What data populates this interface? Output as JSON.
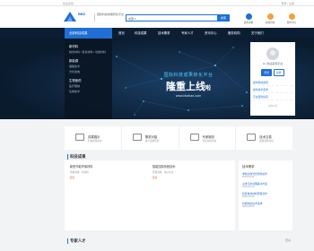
{
  "topbar": {
    "left_text": "欢迎来到",
    "right_text": "登录 | 注册"
  },
  "header": {
    "logo_text": "BBZ",
    "slogan": "国际科技成果转化平台",
    "search": {
      "select_label": "成果 ▾",
      "placeholder": "",
      "button_label": "搜索"
    },
    "icons": [
      {
        "name": "publish",
        "label": "发布需求",
        "color": "#1f6fd6"
      },
      {
        "name": "consult",
        "label": "在线咨询",
        "color": "#f0a23a"
      },
      {
        "name": "service",
        "label": "服务中心",
        "color": "#f0a23a"
      }
    ]
  },
  "nav": {
    "category_label": "全部科技成果",
    "items": [
      "首页",
      "科技成果",
      "技术需求",
      "专家人才",
      "资讯中心",
      "服务机构",
      "关于我们"
    ]
  },
  "sidemenu": [
    {
      "title": "新材料",
      "items": [
        "纳米材料 / 复合材料 / 功能材料"
      ]
    },
    {
      "title": "新能源",
      "items": [
        "储能技术",
        "光伏发电"
      ]
    },
    {
      "title": "生物医药",
      "items": [
        "医疗器械",
        "生物技术"
      ]
    }
  ],
  "banner": {
    "line1": "国际科技成果转化平台",
    "line2": "隆重上线",
    "line2_suffix": "啦",
    "url": "www.bbzhan.com"
  },
  "login": {
    "welcome": "Hi, 欢迎来到平台",
    "login_label": "登录",
    "register_label": "注册",
    "links": [
      "发布科技成果",
      "发布技术需求",
      "平台服务指南"
    ],
    "notice": "平台公告"
  },
  "services": [
    {
      "title": "成果展示",
      "desc": "科技成果发布"
    },
    {
      "title": "需求对接",
      "desc": "技术需求匹配"
    },
    {
      "title": "专家服务",
      "desc": "专家在线咨询"
    },
    {
      "title": "技术交易",
      "desc": "成果转化交易"
    }
  ],
  "section1": {
    "title": "科技成果"
  },
  "cards": [
    {
      "title": "新型节能环保材料",
      "line": "所属领域：新材料",
      "tag": "面议"
    },
    {
      "title": "智能控制系统技术",
      "line": "所属领域：电子信息",
      "tag": "面议"
    }
  ],
  "rpanel": {
    "title": "技术需求",
    "items": [
      {
        "title": "求购高效光伏组件技术",
        "sub": "2019-05-12"
      },
      {
        "title": "寻求污水处理解决方案",
        "sub": "2019-05-10"
      },
      {
        "title": "新型电池材料研发合作",
        "sub": "2019-05-08"
      },
      {
        "title": "智能制造技术需求",
        "sub": "2019-05-06"
      }
    ]
  },
  "section2": {
    "title": "专家人才",
    "more": "更多"
  }
}
